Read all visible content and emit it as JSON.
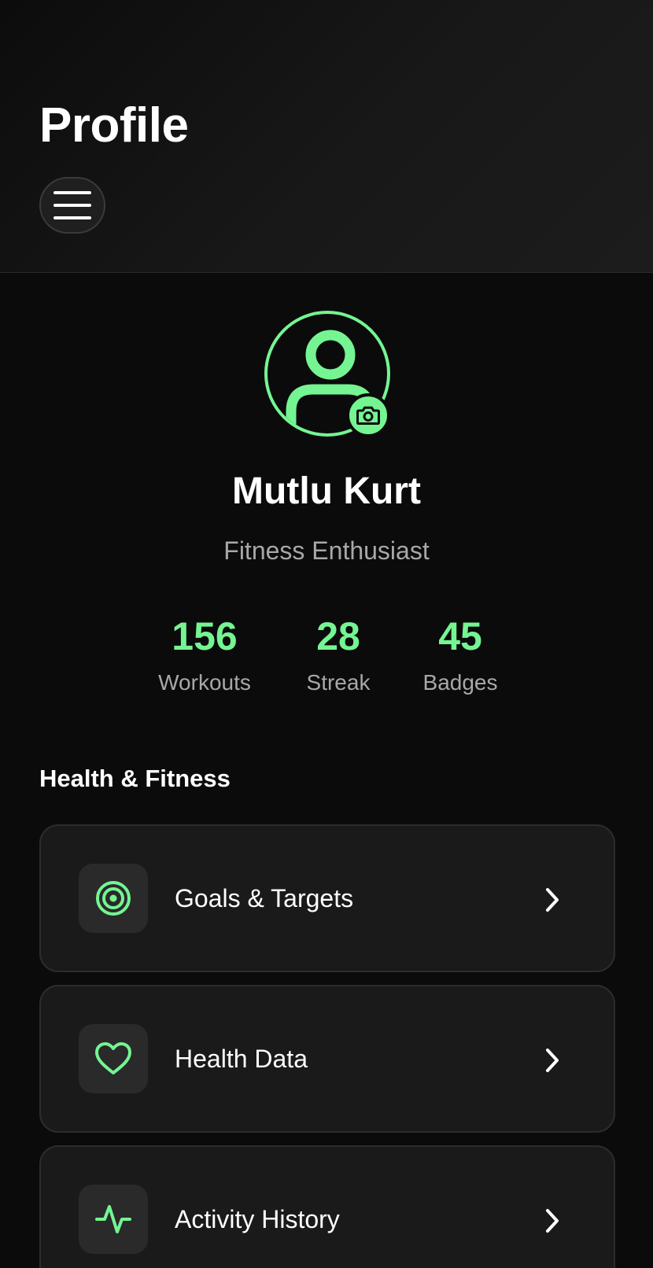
{
  "header": {
    "title": "Profile"
  },
  "profile": {
    "name": "Mutlu Kurt",
    "subtitle": "Fitness Enthusiast",
    "accent_color": "#74f592"
  },
  "stats": [
    {
      "value": "156",
      "label": "Workouts"
    },
    {
      "value": "28",
      "label": "Streak"
    },
    {
      "value": "45",
      "label": "Badges"
    }
  ],
  "section": {
    "title": "Health & Fitness",
    "items": [
      {
        "label": "Goals & Targets",
        "icon": "target-icon"
      },
      {
        "label": "Health Data",
        "icon": "heart-icon"
      },
      {
        "label": "Activity History",
        "icon": "activity-pulse-icon"
      }
    ]
  }
}
